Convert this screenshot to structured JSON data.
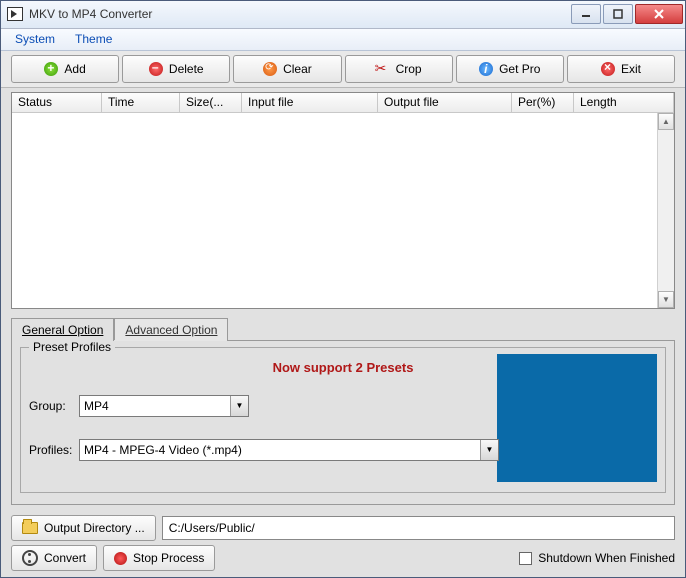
{
  "window": {
    "title": "MKV to MP4 Converter"
  },
  "menu": {
    "system": "System",
    "theme": "Theme"
  },
  "toolbar": {
    "add": "Add",
    "delete": "Delete",
    "clear": "Clear",
    "crop": "Crop",
    "getpro": "Get Pro",
    "exit": "Exit"
  },
  "columns": {
    "status": "Status",
    "time": "Time",
    "size": "Size(...",
    "input": "Input file",
    "output": "Output file",
    "per": "Per(%)",
    "length": "Length"
  },
  "tabs": {
    "general": "General Option",
    "advanced": "Advanced Option"
  },
  "preset": {
    "legend": "Preset Profiles",
    "message": "Now support 2 Presets",
    "group_label": "Group:",
    "group_value": "MP4",
    "profiles_label": "Profiles:",
    "profiles_value": "MP4 - MPEG-4 Video (*.mp4)"
  },
  "output": {
    "button": "Output Directory ...",
    "path": "C:/Users/Public/"
  },
  "footer": {
    "convert": "Convert",
    "stop": "Stop Process",
    "shutdown": "Shutdown When Finished"
  }
}
